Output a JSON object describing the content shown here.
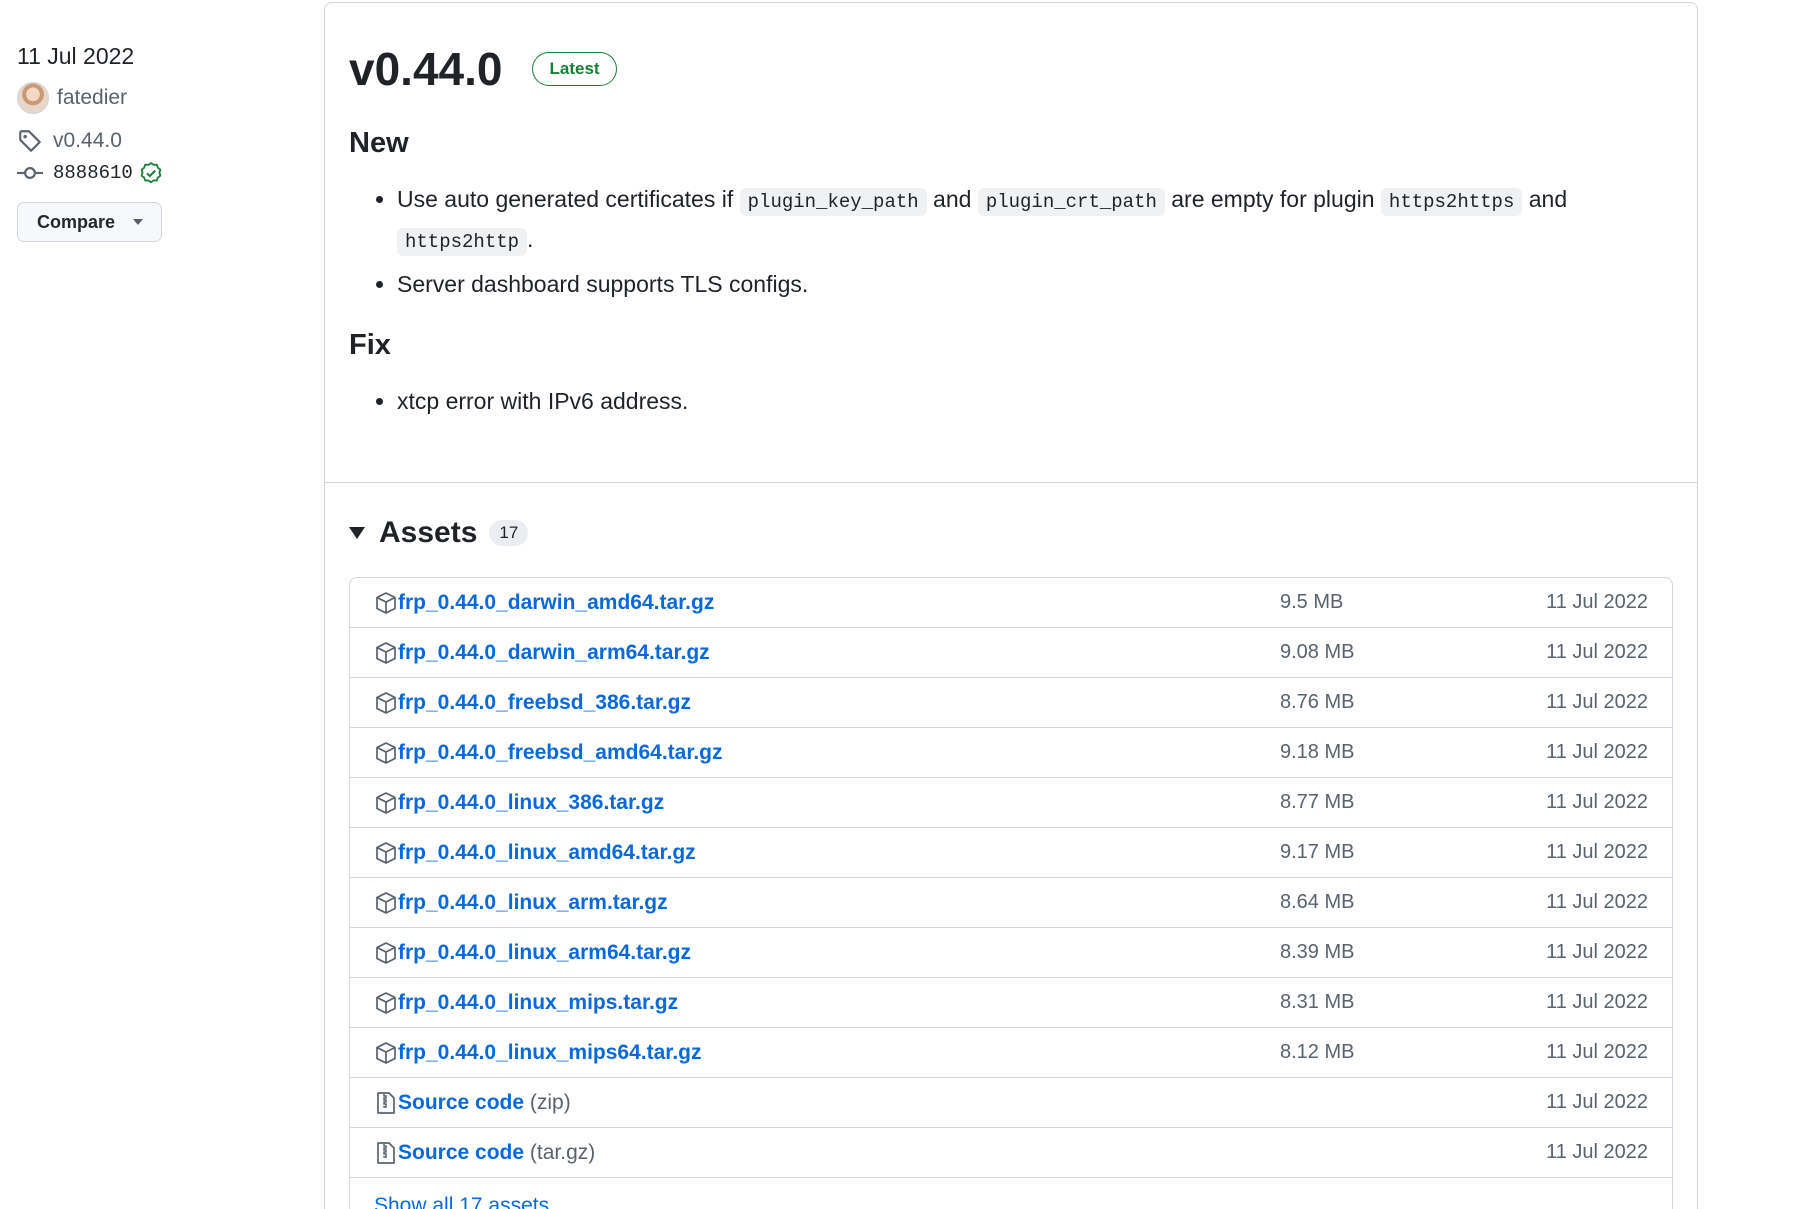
{
  "meta": {
    "date": "11 Jul 2022",
    "author": "fatedier",
    "tag": "v0.44.0",
    "sha": "8888610",
    "compare_label": "Compare"
  },
  "release": {
    "title": "v0.44.0",
    "badge": "Latest",
    "sections": {
      "new_heading": "New",
      "new_item1_a": "Use auto generated certificates if ",
      "new_item1_code1": "plugin_key_path",
      "new_item1_b": " and ",
      "new_item1_code2": "plugin_crt_path",
      "new_item1_c": " are empty for plugin ",
      "new_item1_code3": "https2https",
      "new_item1_d": " and ",
      "new_item1_code4": "https2http",
      "new_item1_e": ".",
      "new_item2": "Server dashboard supports TLS configs.",
      "fix_heading": "Fix",
      "fix_item1": "xtcp error with IPv6 address."
    }
  },
  "assets": {
    "title": "Assets",
    "count": "17",
    "items": [
      {
        "name": "frp_0.44.0_darwin_amd64.tar.gz",
        "size": "9.5 MB",
        "date": "11 Jul 2022"
      },
      {
        "name": "frp_0.44.0_darwin_arm64.tar.gz",
        "size": "9.08 MB",
        "date": "11 Jul 2022"
      },
      {
        "name": "frp_0.44.0_freebsd_386.tar.gz",
        "size": "8.76 MB",
        "date": "11 Jul 2022"
      },
      {
        "name": "frp_0.44.0_freebsd_amd64.tar.gz",
        "size": "9.18 MB",
        "date": "11 Jul 2022"
      },
      {
        "name": "frp_0.44.0_linux_386.tar.gz",
        "size": "8.77 MB",
        "date": "11 Jul 2022"
      },
      {
        "name": "frp_0.44.0_linux_amd64.tar.gz",
        "size": "9.17 MB",
        "date": "11 Jul 2022"
      },
      {
        "name": "frp_0.44.0_linux_arm.tar.gz",
        "size": "8.64 MB",
        "date": "11 Jul 2022"
      },
      {
        "name": "frp_0.44.0_linux_arm64.tar.gz",
        "size": "8.39 MB",
        "date": "11 Jul 2022"
      },
      {
        "name": "frp_0.44.0_linux_mips.tar.gz",
        "size": "8.31 MB",
        "date": "11 Jul 2022"
      },
      {
        "name": "frp_0.44.0_linux_mips64.tar.gz",
        "size": "8.12 MB",
        "date": "11 Jul 2022"
      }
    ],
    "source_zip": {
      "name": "Source code",
      "ext": "(zip)",
      "date": "11 Jul 2022"
    },
    "source_tar": {
      "name": "Source code",
      "ext": "(tar.gz)",
      "date": "11 Jul 2022"
    },
    "show_all": "Show all 17 assets"
  },
  "icons": {
    "tag": "tag-icon",
    "commit": "git-commit-icon",
    "verified": "verified-check-icon",
    "package": "package-icon",
    "zip": "file-zip-icon"
  },
  "colors": {
    "link": "#0969da",
    "latest": "#1a7f37",
    "border": "#d0d7de"
  }
}
